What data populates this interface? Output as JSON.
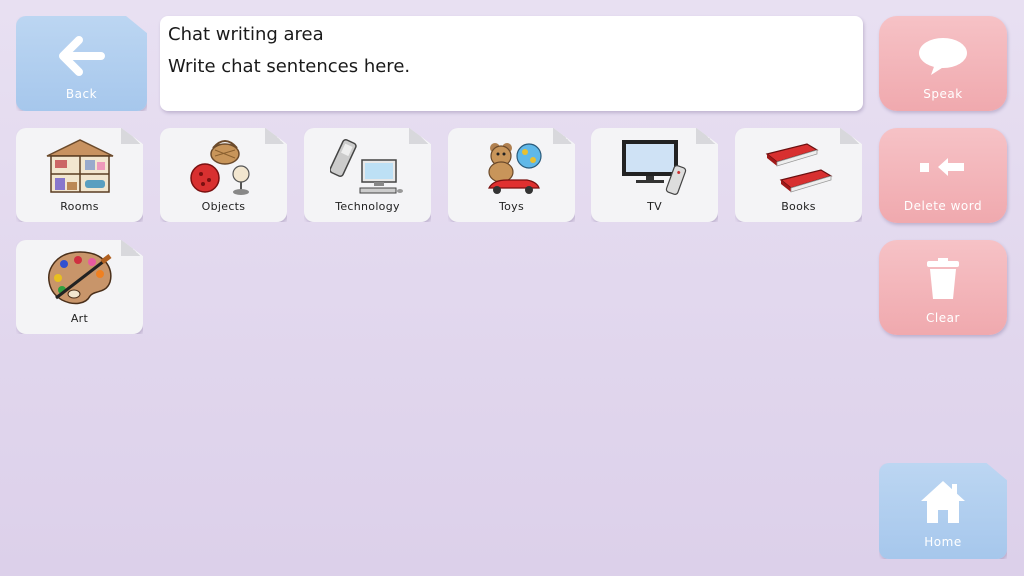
{
  "back": {
    "label": "Back",
    "icon": "arrow-left-icon",
    "color": "#a6c7ec"
  },
  "chat": {
    "title": "Chat writing area",
    "placeholder": "Write chat sentences here."
  },
  "actions": {
    "speak": {
      "label": "Speak",
      "icon": "speech-bubble-icon",
      "color": "#f0a9ae"
    },
    "delete_word": {
      "label": "Delete word",
      "icon": "backspace-arrow-icon",
      "color": "#f0a9ae"
    },
    "clear": {
      "label": "Clear",
      "icon": "trash-icon",
      "color": "#f0a9ae"
    },
    "home": {
      "label": "Home",
      "icon": "home-icon",
      "color": "#a6c7ec"
    }
  },
  "categories": [
    {
      "label": "Rooms",
      "icon": "house-icon"
    },
    {
      "label": "Objects",
      "icon": "objects-icon"
    },
    {
      "label": "Technology",
      "icon": "computer-phone-icon"
    },
    {
      "label": "Toys",
      "icon": "toys-icon"
    },
    {
      "label": "TV",
      "icon": "television-icon"
    },
    {
      "label": "Books",
      "icon": "books-icon"
    },
    {
      "label": "Art",
      "icon": "palette-icon"
    }
  ]
}
